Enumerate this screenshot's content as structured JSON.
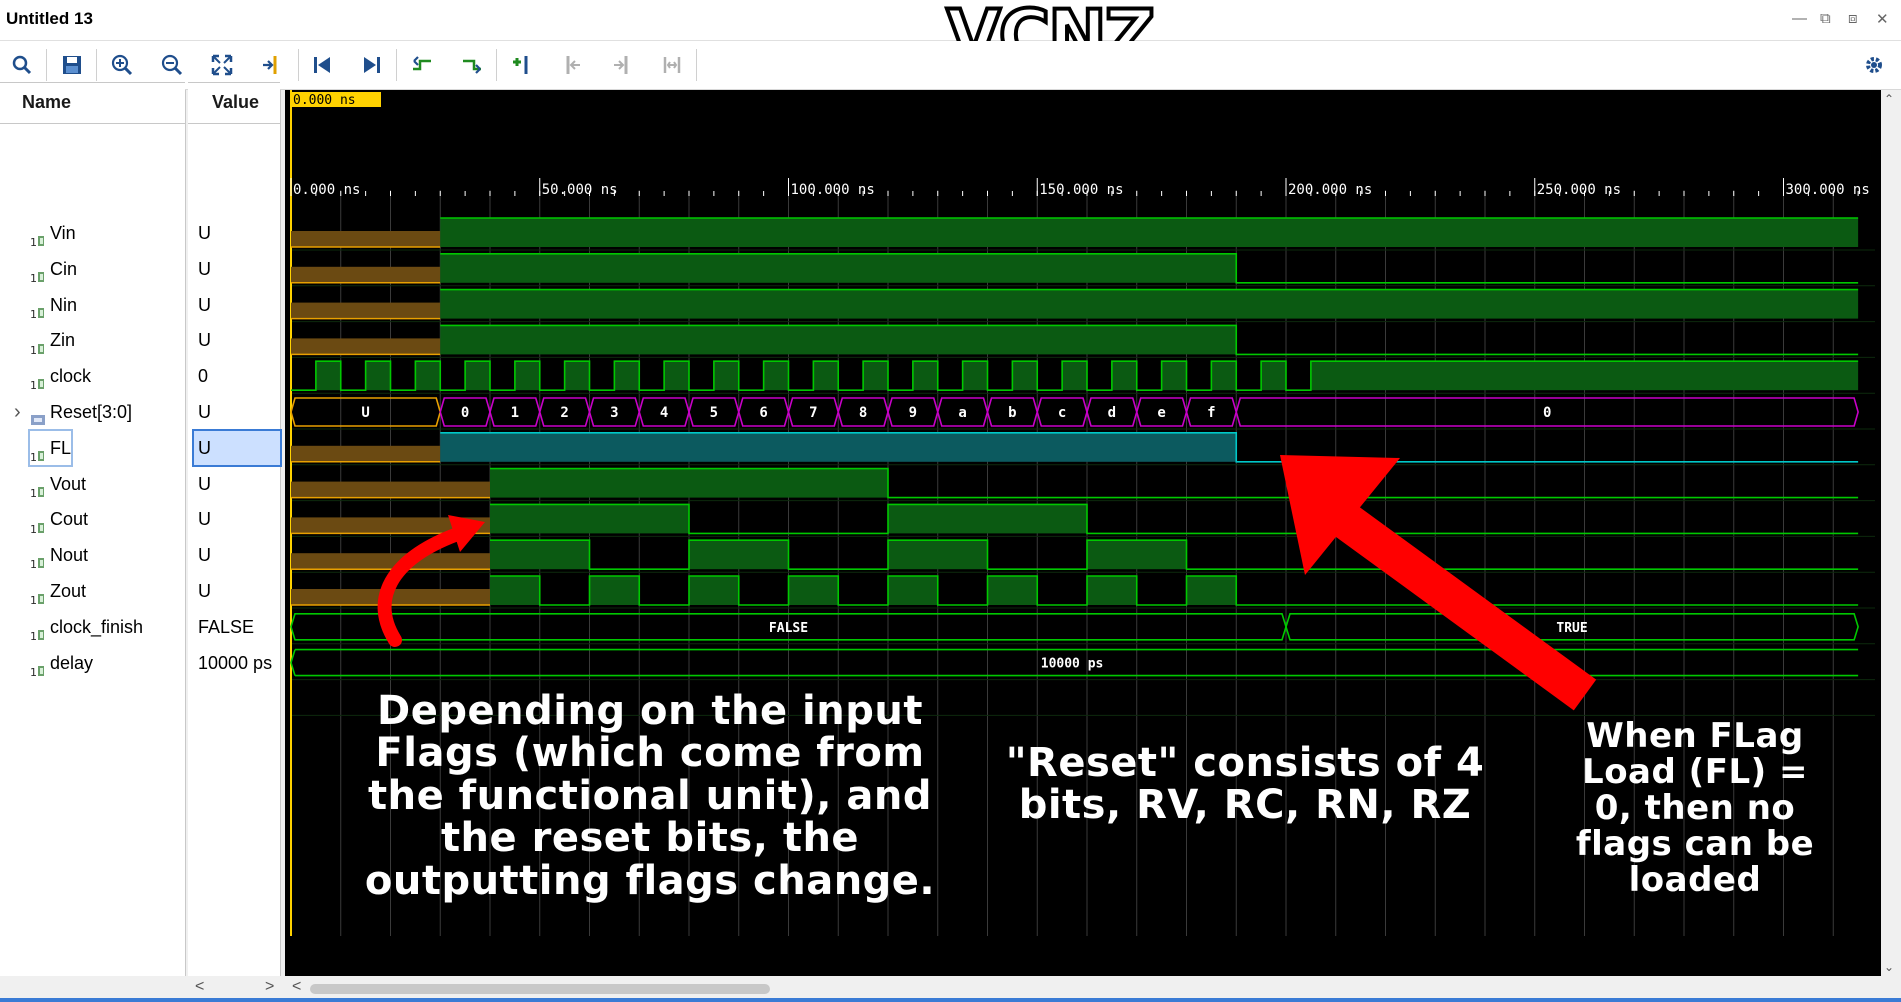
{
  "window": {
    "title": "Untitled 13",
    "logo_text": "VCNZ"
  },
  "toolbar": {
    "icons": [
      "search-icon",
      "save-icon",
      "zoom-in-icon",
      "zoom-out-icon",
      "zoom-fit-icon",
      "go-to-cursor-icon",
      "go-to-start-icon",
      "go-to-end-icon",
      "previous-transition-icon",
      "next-transition-icon",
      "add-marker-icon",
      "previous-marker-icon",
      "next-marker-icon",
      "swap-cursors-icon",
      "settings-gear-icon"
    ]
  },
  "columns": {
    "name": "Name",
    "value": "Value"
  },
  "signals": [
    {
      "name": "Vin",
      "value": "U",
      "icon": "bit-signal-icon"
    },
    {
      "name": "Cin",
      "value": "U",
      "icon": "bit-signal-icon"
    },
    {
      "name": "Nin",
      "value": "U",
      "icon": "bit-signal-icon"
    },
    {
      "name": "Zin",
      "value": "U",
      "icon": "bit-signal-icon"
    },
    {
      "name": "clock",
      "value": "0",
      "icon": "bit-signal-icon"
    },
    {
      "name": "Reset[3:0]",
      "value": "U",
      "icon": "bus-signal-icon"
    },
    {
      "name": "FL",
      "value": "U",
      "icon": "bit-signal-icon"
    },
    {
      "name": "Vout",
      "value": "U",
      "icon": "bit-signal-icon"
    },
    {
      "name": "Cout",
      "value": "U",
      "icon": "bit-signal-icon"
    },
    {
      "name": "Nout",
      "value": "U",
      "icon": "bit-signal-icon"
    },
    {
      "name": "Zout",
      "value": "U",
      "icon": "bit-signal-icon"
    },
    {
      "name": "clock_finish",
      "value": "FALSE",
      "icon": "bit-signal-icon"
    },
    {
      "name": "delay",
      "value": "10000 ps",
      "icon": "bit-signal-icon"
    }
  ],
  "cursor": {
    "label": "0.000 ns",
    "time_ns": 0
  },
  "timeline": {
    "ticks": [
      "0.000 ns",
      "50.000 ns",
      "100.000 ns",
      "150.000 ns",
      "200.000 ns",
      "250.000 ns",
      "300.000 ns"
    ],
    "colors": {
      "bit": "#00c800",
      "bus": "#c800c8",
      "undef": "#e8a000",
      "selected": "#00c8c8"
    }
  },
  "bus_values": {
    "reset": [
      "U",
      "0",
      "1",
      "2",
      "3",
      "4",
      "5",
      "6",
      "7",
      "8",
      "9",
      "a",
      "b",
      "c",
      "d",
      "e",
      "f",
      "0"
    ],
    "clock_finish": [
      "FALSE",
      "TRUE"
    ],
    "delay": [
      "10000 ps"
    ]
  },
  "annotations": {
    "left": "Depending on the input Flags (which come from the functional unit), and the reset bits, the outputting flags change.",
    "middle": "\"Reset\" consists of 4 bits, RV, RC, RN, RZ",
    "right": "When FLag Load (FL) = 0, then no flags can be loaded"
  }
}
